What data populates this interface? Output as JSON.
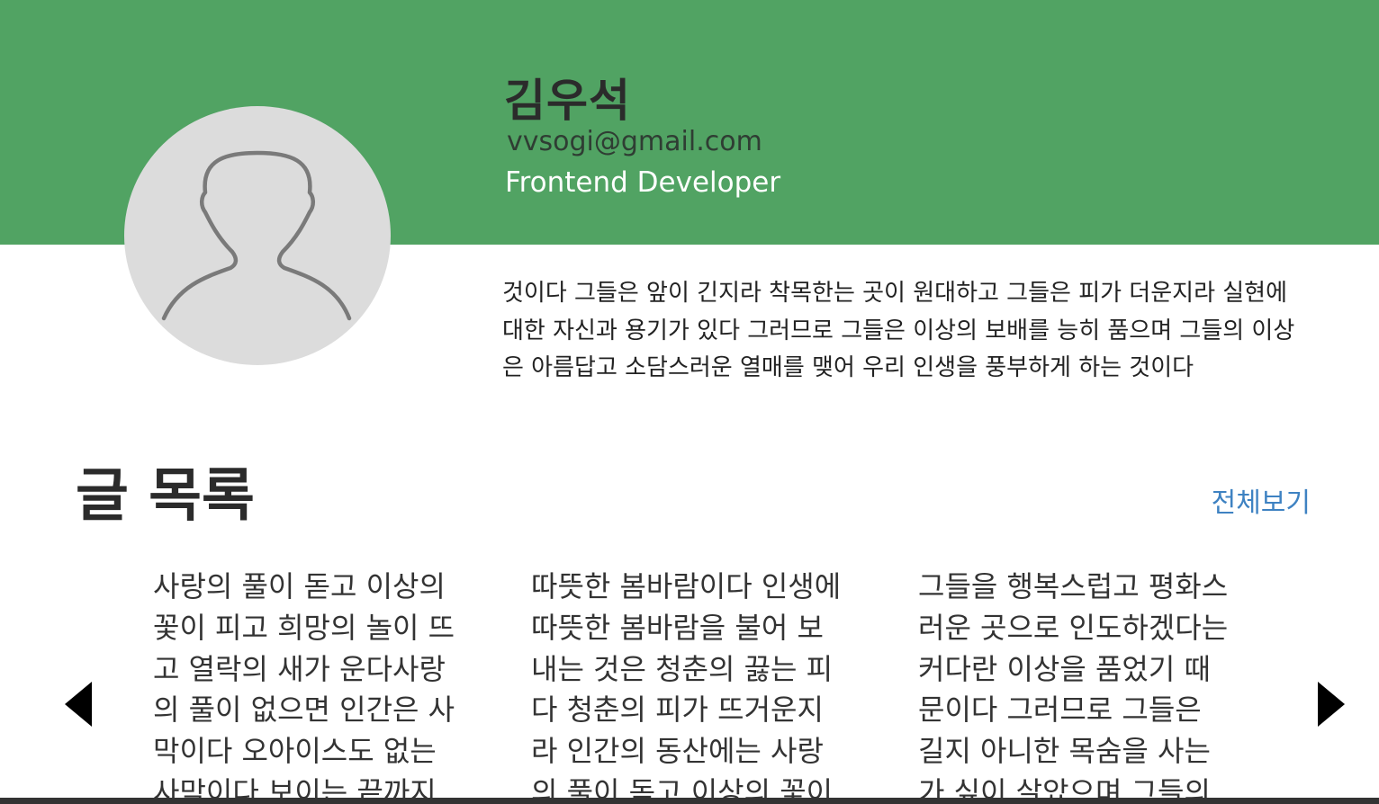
{
  "profile": {
    "name": "김우석",
    "email": "vvsogi@gmail.com",
    "role": "Frontend Developer",
    "bio": "것이다 그들은 앞이 긴지라 착목한는 곳이 원대하고 그들은 피가 더운지라 실현에 대한 자신과 용기가 있다 그러므로 그들은 이상의 보배를 능히 품으며 그들의 이상은 아름답고 소담스러운 열매를 맺어 우리 인생을 풍부하게 하는 것이다",
    "avatar_icon": "user-silhouette-icon"
  },
  "posts_section": {
    "title": "글 목록",
    "view_all_label": "전체보기",
    "prev_icon": "arrow-left-icon",
    "next_icon": "arrow-right-icon",
    "posts": [
      {
        "text": "사랑의 풀이 돋고 이상의\n꽃이 피고 희망의 놀이 뜨\n고 열락의 새가 운다사랑\n의 풀이 없으면 인간은 사\n막이다 오아이스도 없는\n사막이다 보이는 끝까지"
      },
      {
        "text": "따뜻한 봄바람이다 인생에\n따뜻한 봄바람을 불어 보\n내는 것은 청춘의 끓는 피\n다 청춘의 피가 뜨거운지\n라 인간의 동산에는 사랑\n의 풀이 돋고 이상의 꽃이"
      },
      {
        "text": "그들을 행복스럽고 평화스\n러운 곳으로 인도하겠다는\n커다란 이상을 품었기 때\n문이다 그러므로 그들은\n길지 아니한 목숨을 사는\n가 싶이 살았으며 그들의"
      }
    ]
  },
  "colors": {
    "header_green": "#51a363",
    "link_blue": "#3e82c2",
    "avatar_bg": "#dcdcdc"
  }
}
